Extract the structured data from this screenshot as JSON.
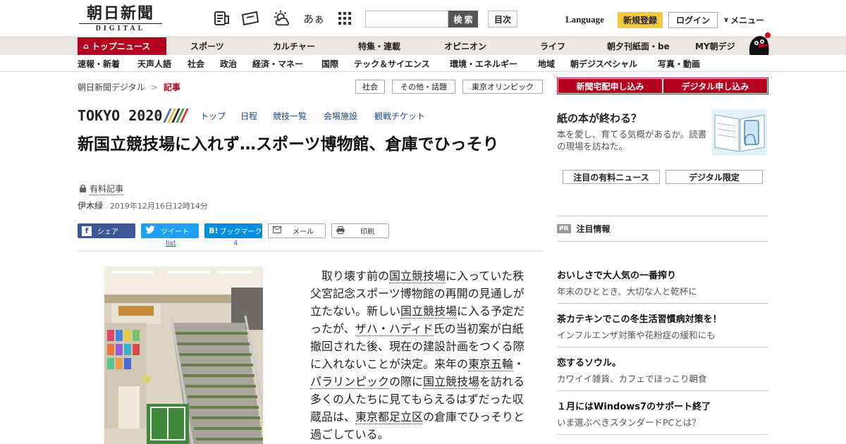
{
  "header": {
    "logo_jp": "朝日新聞",
    "logo_en": "DIGITAL",
    "icon_text_size": "あぁ",
    "search_placeholder": "",
    "search_button": "検 索",
    "toc_button": "目次",
    "language": "Language",
    "signup": "新規登録",
    "login": "ログイン",
    "menu": "メニュー"
  },
  "nav_primary": [
    "トップニュース",
    "スポーツ",
    "カルチャー",
    "特集・連載",
    "オピニオン",
    "ライフ",
    "朝夕刊紙面・be",
    "MY朝デジ"
  ],
  "nav_secondary": [
    "速報・新着",
    "天声人語",
    "社会",
    "政治",
    "経済・マネー",
    "国際",
    "テック＆サイエンス",
    "環境・エネルギー",
    "地域",
    "朝デジスペシャル",
    "写真・動画"
  ],
  "breadcrumb": {
    "home": "朝日新聞デジタル",
    "sep": ">",
    "current": "記事"
  },
  "tags": [
    "社会",
    "その他・話題",
    "東京オリンピック"
  ],
  "tokyo2020": {
    "logo": "TOKYO 2020",
    "links": [
      "トップ",
      "日程",
      "競技一覧",
      "会場施設",
      "観戦チケット"
    ]
  },
  "article": {
    "title": "新国立競技場に入れず…スポーツ博物館、倉庫でひっそり",
    "paid_label": "有料記事",
    "author": "伊木緑",
    "date": "2019年12月16日12時14分",
    "body_segments": [
      {
        "t": "　取り壊す前の",
        "l": false
      },
      {
        "t": "国立競技場",
        "l": true
      },
      {
        "t": "に入っていた秩父宮記念スポーツ博物館の再開の見通しが立たない。新しい",
        "l": false
      },
      {
        "t": "国立競技場",
        "l": true
      },
      {
        "t": "に入る予定だったが、",
        "l": false
      },
      {
        "t": "ザハ・ハディド",
        "l": true
      },
      {
        "t": "氏の当初案が白紙撤回された後、現在の建設計画をつくる際に入れないことが決定。来年の",
        "l": false
      },
      {
        "t": "東京五輪",
        "l": true
      },
      {
        "t": "・",
        "l": false
      },
      {
        "t": "パラリンピック",
        "l": true
      },
      {
        "t": "の際に",
        "l": false
      },
      {
        "t": "国立競技場",
        "l": true
      },
      {
        "t": "を訪れる多くの人たちに見てもらえるはずだった収蔵品は、",
        "l": false
      },
      {
        "t": "東京都",
        "l": true
      },
      {
        "t": "足立区",
        "l": true
      },
      {
        "t": "の倉庫でひっそりと過ごしている。",
        "l": false
      }
    ]
  },
  "share": {
    "facebook": "シェア",
    "twitter": "ツイート",
    "twitter_count": "list",
    "hatena": "ブックマーク",
    "hatena_count": "4",
    "mail": "メール",
    "print": "印刷"
  },
  "sidebar": {
    "subscribe_paper": "新聞宅配申し込み",
    "subscribe_digital": "デジタル申し込み",
    "promo_title": "紙の本が終わる？",
    "promo_desc": "本を愛し、育てる気概があるか。読書の現場を訪ねた。",
    "btn_paid_news": "注目の有料ニュース",
    "btn_digital_only": "デジタル限定",
    "pr_badge": "PR",
    "pr_heading": "注目情報",
    "ads": [
      {
        "title": "おいしさで大人気の一番搾り",
        "desc": "年末のひととき、大切な人と乾杯に"
      },
      {
        "title": "茶カテキンでこの冬生活習慣病対策を！",
        "desc": "インフルエンザ対策や花粉症の緩和にも"
      },
      {
        "title": "恋するソウル。",
        "desc": "カワイイ雑貨、カフェでほっこり朝食"
      },
      {
        "title": "１月にはWindows7のサポート終了",
        "desc": "いま選ぶべきスタンダードPCとは？"
      }
    ]
  },
  "colors": {
    "brand_red": "#b5001f",
    "signup_yellow": "#f4c842",
    "link_blue": "#1a4a8a"
  }
}
